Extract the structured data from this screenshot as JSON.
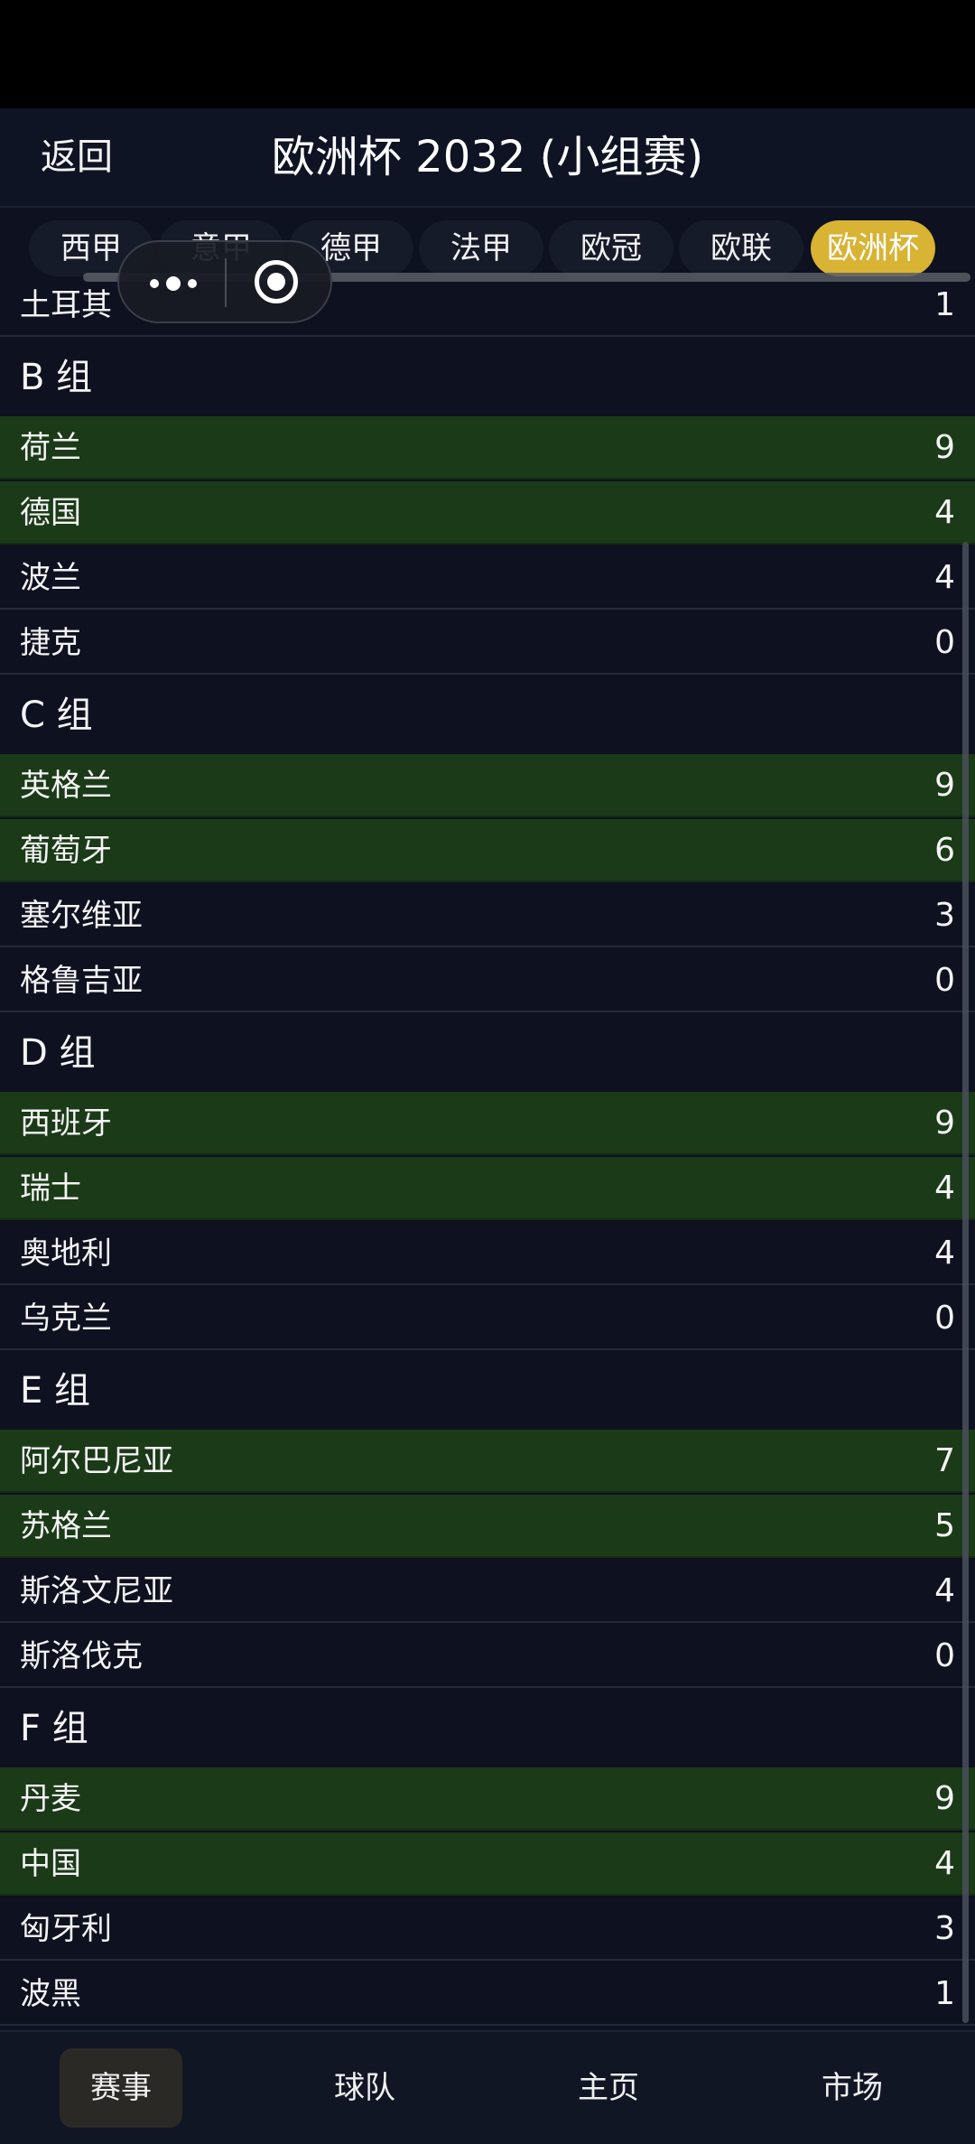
{
  "header": {
    "back_label": "返回",
    "title": "欧洲杯 2032 (小组赛)"
  },
  "tabs": [
    {
      "label": "西甲",
      "active": false
    },
    {
      "label": "意甲",
      "active": false
    },
    {
      "label": "德甲",
      "active": false
    },
    {
      "label": "法甲",
      "active": false
    },
    {
      "label": "欧冠",
      "active": false
    },
    {
      "label": "欧联",
      "active": false
    },
    {
      "label": "欧洲杯",
      "active": true
    }
  ],
  "capsule": {
    "menu_icon": "more-dots-icon",
    "close_icon": "target-icon"
  },
  "standings": {
    "partial_row": {
      "team": "土耳其",
      "points": "1"
    },
    "groups": [
      {
        "name": "B 组",
        "rows": [
          {
            "team": "荷兰",
            "points": "9",
            "qualified": true
          },
          {
            "team": "德国",
            "points": "4",
            "qualified": true
          },
          {
            "team": "波兰",
            "points": "4",
            "qualified": false
          },
          {
            "team": "捷克",
            "points": "0",
            "qualified": false
          }
        ]
      },
      {
        "name": "C 组",
        "rows": [
          {
            "team": "英格兰",
            "points": "9",
            "qualified": true
          },
          {
            "team": "葡萄牙",
            "points": "6",
            "qualified": true
          },
          {
            "team": "塞尔维亚",
            "points": "3",
            "qualified": false
          },
          {
            "team": "格鲁吉亚",
            "points": "0",
            "qualified": false
          }
        ]
      },
      {
        "name": "D 组",
        "rows": [
          {
            "team": "西班牙",
            "points": "9",
            "qualified": true
          },
          {
            "team": "瑞士",
            "points": "4",
            "qualified": true
          },
          {
            "team": "奥地利",
            "points": "4",
            "qualified": false
          },
          {
            "team": "乌克兰",
            "points": "0",
            "qualified": false
          }
        ]
      },
      {
        "name": "E 组",
        "rows": [
          {
            "team": "阿尔巴尼亚",
            "points": "7",
            "qualified": true
          },
          {
            "team": "苏格兰",
            "points": "5",
            "qualified": true
          },
          {
            "team": "斯洛文尼亚",
            "points": "4",
            "qualified": false
          },
          {
            "team": "斯洛伐克",
            "points": "0",
            "qualified": false
          }
        ]
      },
      {
        "name": "F 组",
        "rows": [
          {
            "team": "丹麦",
            "points": "9",
            "qualified": true
          },
          {
            "team": "中国",
            "points": "4",
            "qualified": true
          },
          {
            "team": "匈牙利",
            "points": "3",
            "qualified": false
          },
          {
            "team": "波黑",
            "points": "1",
            "qualified": false
          }
        ]
      }
    ]
  },
  "bottom_nav": [
    {
      "label": "赛事",
      "active": true
    },
    {
      "label": "球队",
      "active": false
    },
    {
      "label": "主页",
      "active": false
    },
    {
      "label": "市场",
      "active": false
    }
  ],
  "colors": {
    "background": "#0d1120",
    "qualified_row": "#1b3a18",
    "active_tab": "#d8b334"
  }
}
